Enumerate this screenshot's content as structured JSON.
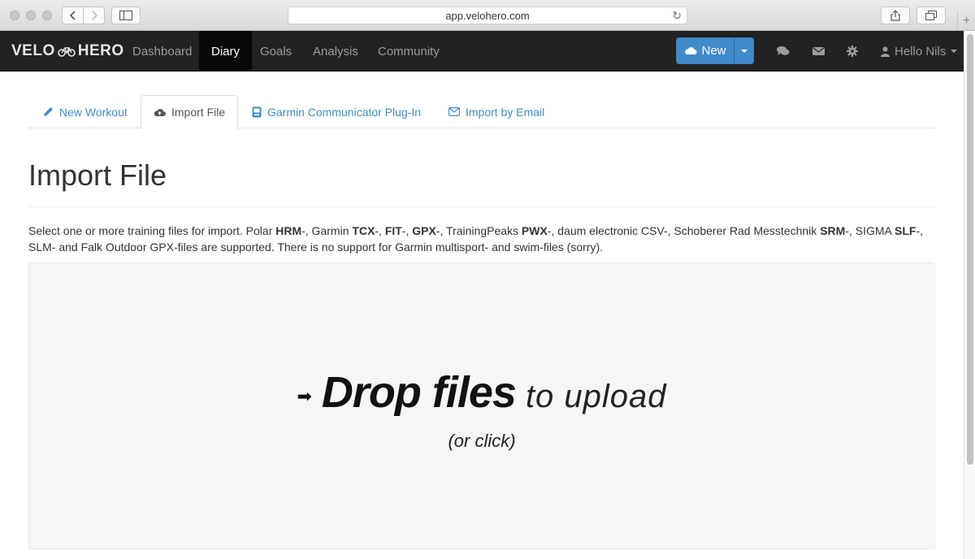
{
  "browser": {
    "url": "app.velohero.com"
  },
  "navbar": {
    "brand_left": "VELO",
    "brand_right": "HERO",
    "items": [
      {
        "label": "Dashboard"
      },
      {
        "label": "Diary"
      },
      {
        "label": "Goals"
      },
      {
        "label": "Analysis"
      },
      {
        "label": "Community"
      }
    ],
    "new_label": "New",
    "user_label": "Hello Nils"
  },
  "tabs": [
    {
      "label": "New Workout",
      "icon": "pencil-icon"
    },
    {
      "label": "Import File",
      "icon": "cloud-upload-icon"
    },
    {
      "label": "Garmin Communicator Plug-In",
      "icon": "garmin-device-icon"
    },
    {
      "label": "Import by Email",
      "icon": "envelope-icon"
    }
  ],
  "page": {
    "title": "Import File",
    "desc": {
      "t1": "Select one or more training files for import. Polar ",
      "b1": "HRM",
      "t2": "-, Garmin ",
      "b2": "TCX",
      "t3": "-, ",
      "b3": "FIT",
      "t4": "-, ",
      "b4": "GPX",
      "t5": "-, TrainingPeaks ",
      "b5": "PWX",
      "t6": "-, daum electronic CSV-, Schoberer Rad Messtechnik ",
      "b6": "SRM",
      "t7": "-, SIGMA ",
      "b7": "SLF",
      "t8": "-, SLM- and Falk Outdoor GPX-files are supported. There is no support for Garmin multisport- and swim-files (sorry)."
    },
    "dropzone": {
      "strong": "Drop files",
      "light": "to upload",
      "sub": "(or click)"
    }
  },
  "colors": {
    "navbar_bg": "#222222",
    "accent": "#428bca",
    "link": "#428bca"
  }
}
